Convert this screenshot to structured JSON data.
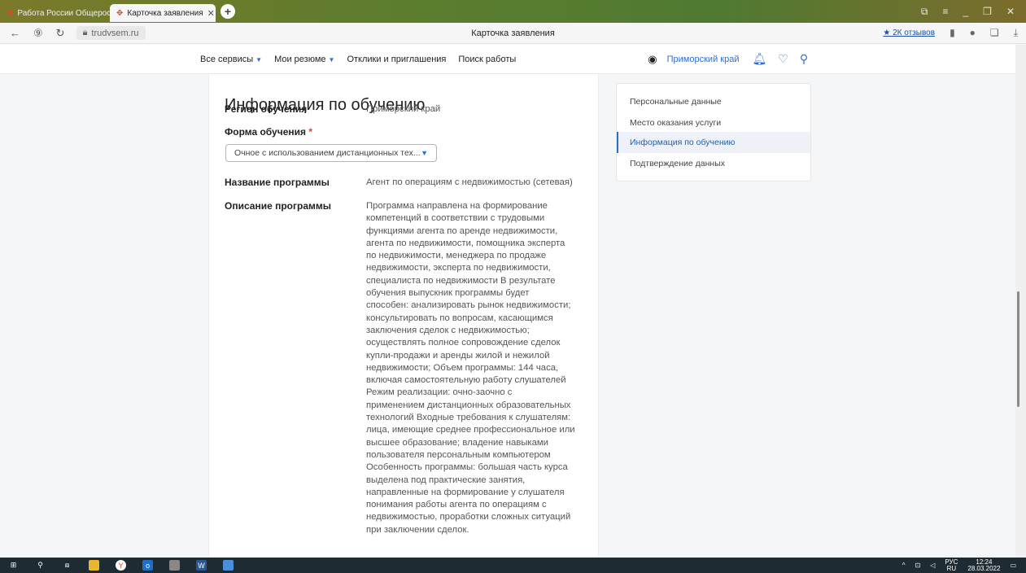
{
  "browser": {
    "tabs": [
      {
        "title": "Работа России Общерос",
        "active": false
      },
      {
        "title": "Карточка заявления",
        "active": true
      }
    ],
    "url": "trudvsem.ru",
    "page_title": "Карточка заявления",
    "reviews_label": "★ 2К отзывов"
  },
  "header": {
    "nav": [
      {
        "label": "Все сервисы",
        "dropdown": true
      },
      {
        "label": "Мои резюме",
        "dropdown": true
      },
      {
        "label": "Отклики и приглашения",
        "dropdown": false
      },
      {
        "label": "Поиск работы",
        "dropdown": false
      }
    ],
    "region": "Приморский край"
  },
  "main": {
    "section_title": "Информация по обучению",
    "region_label": "Регион обучения",
    "region_value": "Приморский край",
    "form_label": "Форма обучения",
    "form_required": "*",
    "form_value": "Очное с использованием дистанционных тех...",
    "program_name_label": "Название программы",
    "program_name_value": "Агент по операциям с недвижимостью (сетевая)",
    "program_desc_label": "Описание программы",
    "program_desc_lines": [
      "Программа направлена на формирование",
      "компетенций в соответствии с трудовыми",
      "функциями агента по аренде недвижимости,",
      "агента по недвижимости, помощника эксперта",
      "по недвижимости, менеджера по продаже",
      "недвижимости, эксперта по недвижимости,",
      "специалиста по недвижимости В результате",
      "обучения выпускник программы будет",
      "способен: анализировать рынок недвижимости;",
      "консультировать по вопросам, касающимся",
      "заключения сделок с недвижимостью;",
      "осуществлять полное сопровождение сделок",
      "купли-продажи и аренды жилой и нежилой",
      "недвижимости; Объем программы: 144 часа,",
      "включая самостоятельную работу слушателей",
      "Режим реализации: очно-заочно с",
      "применением дистанционных образовательных",
      "технологий Входные требования к слушателям:",
      "лица, имеющие среднее профессиональное или",
      "высшее образование; владение навыками",
      "пользователя персональным компьютером",
      "Особенность программы: большая часть курса",
      "выделена под практические занятия,",
      "направленные на формирование у слушателя",
      "понимания работы агента по операциям с",
      "недвижимостью, проработки сложных ситуаций",
      "при заключении сделок."
    ]
  },
  "sidenav": {
    "items": [
      {
        "label": "Персональные данные",
        "active": false
      },
      {
        "label": "Место оказания услуги",
        "active": false
      },
      {
        "label": "Информация по обучению",
        "active": true
      },
      {
        "label": "Подтверждение данных",
        "active": false
      }
    ]
  },
  "taskbar": {
    "lang_top": "РУС",
    "lang_bottom": "RU",
    "time": "12:24",
    "date": "28.03.2022"
  }
}
